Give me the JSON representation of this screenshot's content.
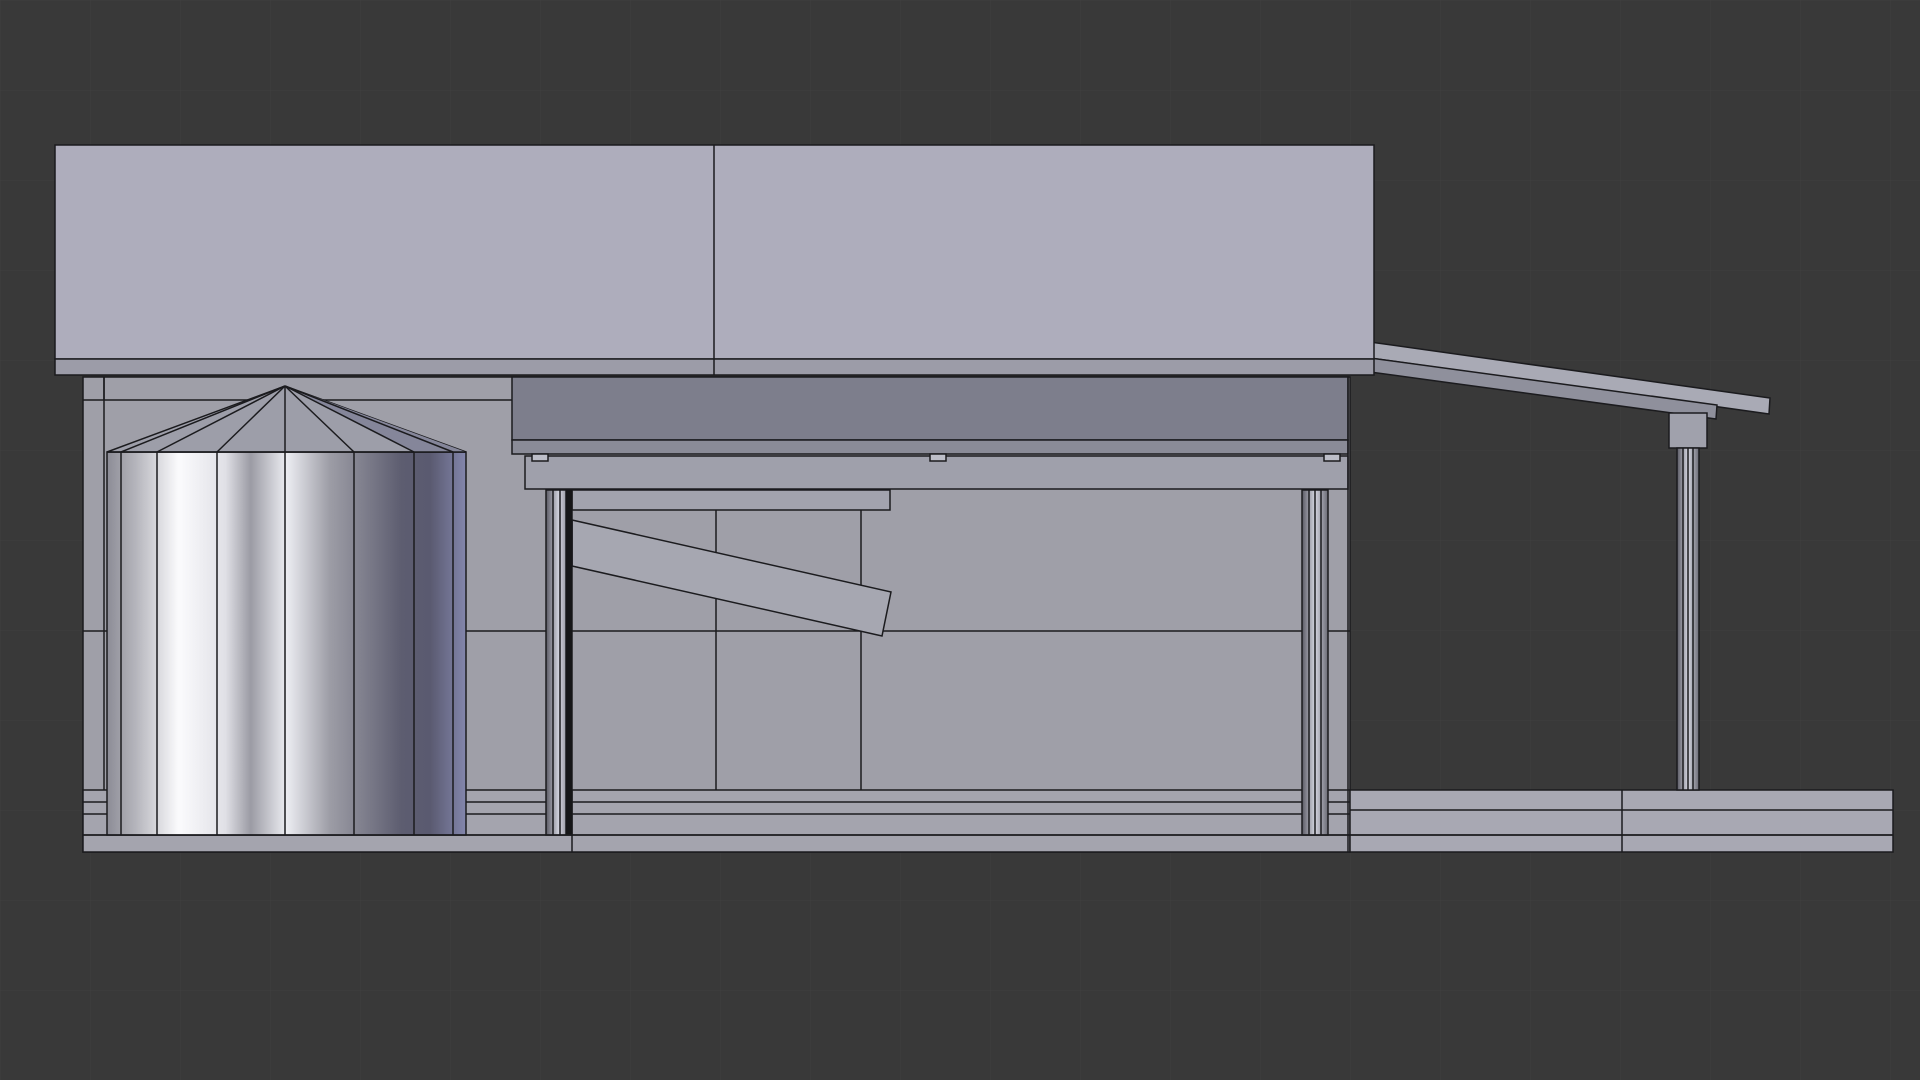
{
  "viewport": {
    "background": "#393939",
    "grid_color": "#404040",
    "grid_visible": true
  },
  "scene": {
    "object": "farm-building-orthographic-front-view",
    "shading": "solid",
    "wireframe_edges": true,
    "colors": {
      "edge": "#1b1b1e",
      "roof": "#aeadbc",
      "roof_trim": "#9c9ca8",
      "wall": "#9f9fa8",
      "wall_dark": "#9a9aa3",
      "beam": "#7d7e8c",
      "beam_lower": "#8a8b97",
      "floor": "#a8a8b3",
      "post": "#c5c6d2",
      "silo_highlight": "#ffffff",
      "silo_shadow": "#55556a",
      "silo_edge_tint": "#7f82a8"
    }
  }
}
